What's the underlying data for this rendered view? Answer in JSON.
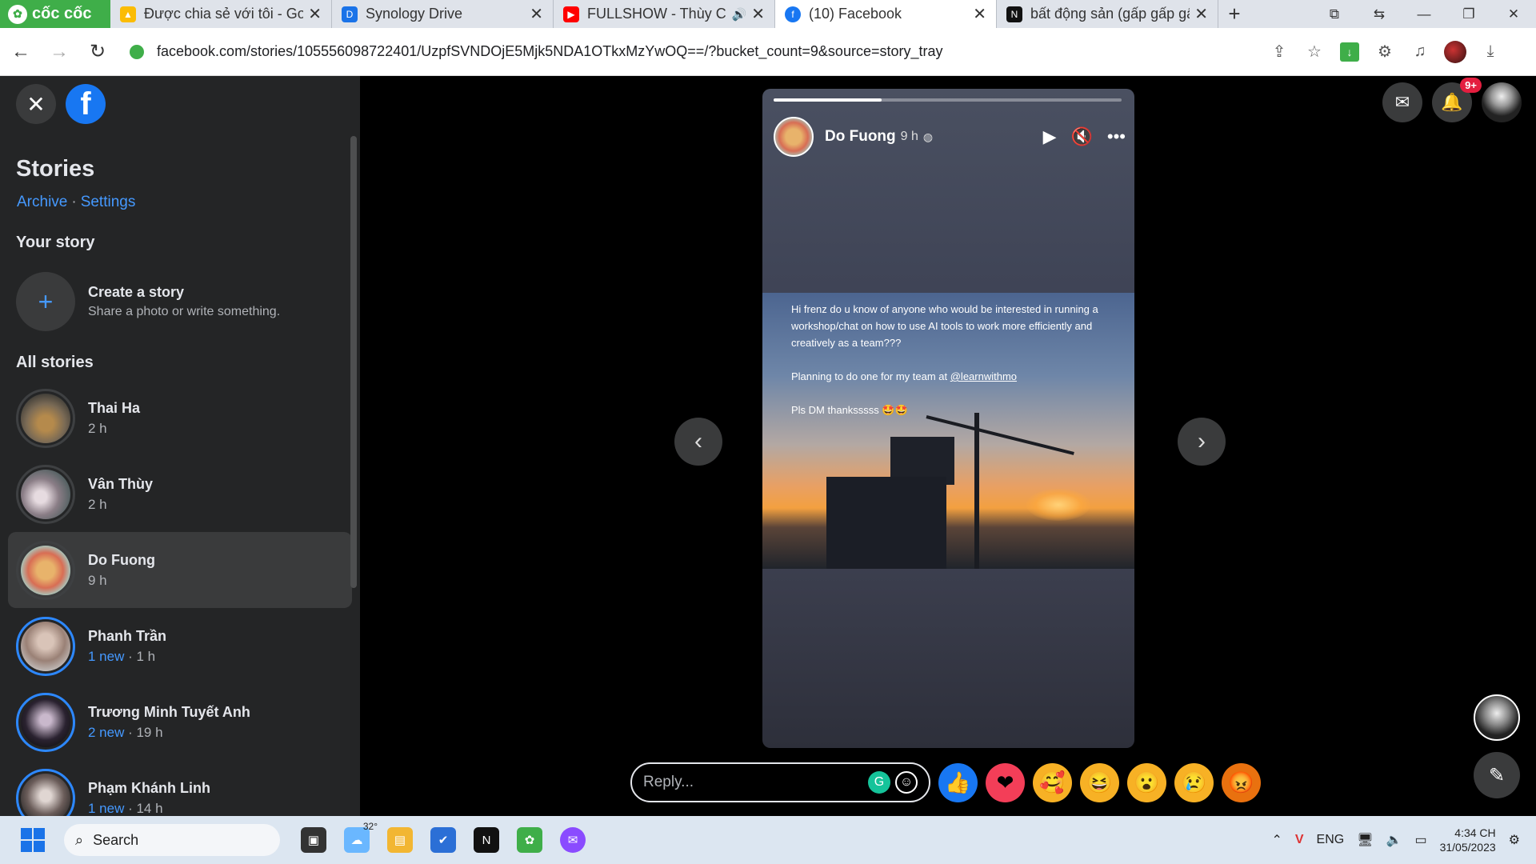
{
  "browser": {
    "brand": "cốc cốc",
    "tabs": [
      {
        "label": "Được chia sẻ với tôi - Goo",
        "icon": "google-drive-icon",
        "color": "#fbbc04"
      },
      {
        "label": "Synology Drive",
        "icon": "synology-drive-icon",
        "color": "#1a73e8"
      },
      {
        "label": "FULLSHOW - Thùy Chi",
        "icon": "youtube-icon",
        "color": "#ff0000"
      },
      {
        "label": "(10) Facebook",
        "icon": "facebook-icon",
        "color": "#1877f2"
      },
      {
        "label": "bất động sản (gấp gấp gấ",
        "icon": "notion-icon",
        "color": "#111111"
      }
    ],
    "url": "facebook.com/stories/105556098722401/UzpfSVNDOjE5Mjk5NDA1OTkxMzYwOQ==/?bucket_count=9&source=story_tray"
  },
  "sidebar": {
    "title": "Stories",
    "archive": "Archive",
    "separator": "·",
    "settings": "Settings",
    "your_story": "Your story",
    "create_title": "Create a story",
    "create_sub": "Share a photo or write something.",
    "all_stories": "All stories",
    "stories": [
      {
        "name": "Thai Ha",
        "new": "",
        "time": "2 h"
      },
      {
        "name": "Vân Thùy",
        "new": "",
        "time": "2 h"
      },
      {
        "name": "Do Fuong",
        "new": "",
        "time": "9 h"
      },
      {
        "name": "Phanh Trần",
        "new": "1 new",
        "time": " · 1 h"
      },
      {
        "name": "Trương Minh Tuyết Anh",
        "new": "2 new",
        "time": " · 19 h"
      },
      {
        "name": "Phạm Khánh Linh",
        "new": "1 new",
        "time": " · 14 h"
      }
    ]
  },
  "story": {
    "author": "Do Fuong",
    "time": "9 h",
    "text_1": "Hi frenz do u know of anyone who would be interested in running a workshop/chat on how to use AI tools to work more efficiently and creatively as a team???",
    "text_2_prefix": "Planning to do one for my team at ",
    "mention": "@learnwithmo",
    "text_3": "Pls DM thanksssss 🤩🤩",
    "progress": 0.31
  },
  "header": {
    "notification_badge": "9+"
  },
  "reply": {
    "placeholder": "Reply..."
  },
  "reactions": [
    {
      "name": "like",
      "glyph": "👍",
      "color": "#1877f2"
    },
    {
      "name": "love",
      "glyph": "❤",
      "color": "#f33e58"
    },
    {
      "name": "care",
      "glyph": "🥰",
      "color": "#f7b125"
    },
    {
      "name": "haha",
      "glyph": "😆",
      "color": "#f7b125"
    },
    {
      "name": "wow",
      "glyph": "😮",
      "color": "#f7b125"
    },
    {
      "name": "sad",
      "glyph": "😢",
      "color": "#f7b125"
    },
    {
      "name": "angry",
      "glyph": "😡",
      "color": "#e9710f"
    }
  ],
  "taskbar": {
    "search": "Search",
    "temperature": "32°",
    "language": "ENG",
    "time": "4:34 CH",
    "date": "31/05/2023"
  }
}
